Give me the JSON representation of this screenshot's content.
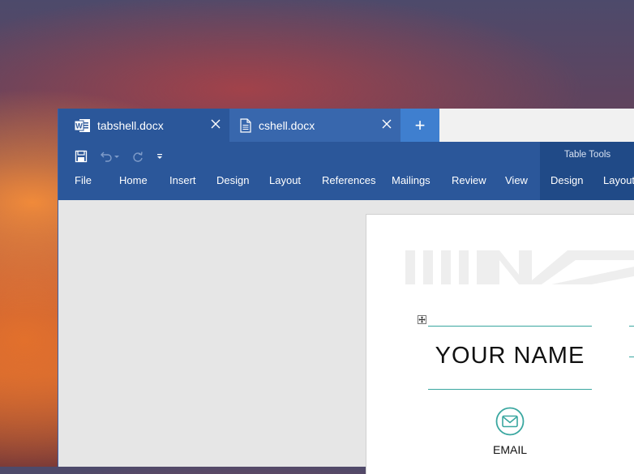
{
  "tabs": [
    {
      "label": "tabshell.docx",
      "icon": "word-icon",
      "active": true
    },
    {
      "label": "cshell.docx",
      "icon": "document-icon",
      "active": false
    }
  ],
  "new_tab_label": "+",
  "ribbon": {
    "contextual_group": "Table Tools",
    "menus": [
      "File",
      "Home",
      "Insert",
      "Design",
      "Layout",
      "References",
      "Mailings",
      "Review",
      "View"
    ],
    "contextual_menus": [
      "Design",
      "Layout"
    ]
  },
  "document": {
    "name_text": "YOUR NAME",
    "email_label": "EMAIL"
  },
  "colors": {
    "ribbon": "#2b579a",
    "contextual": "#204a87",
    "new_tab": "#3f7fcf",
    "accent_rule": "#3aa7a0"
  }
}
